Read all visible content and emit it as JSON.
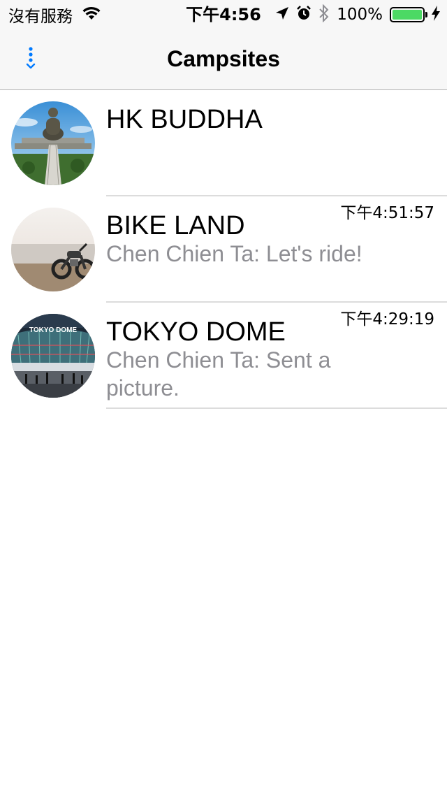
{
  "status_bar": {
    "carrier": "沒有服務",
    "time": "下午4:56",
    "battery_percent": "100%",
    "battery_level": 1.0,
    "icons": [
      "wifi-icon",
      "location-arrow-icon",
      "alarm-icon",
      "bluetooth-icon",
      "charging-bolt-icon"
    ]
  },
  "nav": {
    "title": "Campsites",
    "menu_icon": "vertical-dots-menu-icon",
    "accent_color": "#007aff"
  },
  "campsites": [
    {
      "name": "HK BUDDHA",
      "time": "",
      "last_message": "",
      "avatar": "buddha-statue-photo"
    },
    {
      "name": "BIKE LAND",
      "time": "下午4:51:57",
      "last_message": "Chen Chien Ta: Let's ride!",
      "avatar": "motorcycle-photo"
    },
    {
      "name": "TOKYO DOME",
      "time": "下午4:29:19",
      "last_message": "Chen Chien Ta: Sent a picture.",
      "avatar": "tokyo-dome-photo",
      "avatar_sign": "TOKYO DOME"
    }
  ],
  "colors": {
    "subtitle": "#8e8e93",
    "separator": "#dcdcdc",
    "battery": "#4cd964"
  }
}
